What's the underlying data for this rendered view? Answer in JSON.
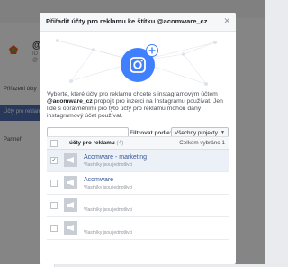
{
  "background": {
    "page_name": "@",
    "page_sub": [
      "ID",
      "@"
    ],
    "sidebar": [
      {
        "label": "Přiřazení účty"
      },
      {
        "label": "Účty pro reklamu",
        "active": true
      },
      {
        "label": "Partneři"
      }
    ]
  },
  "modal": {
    "title": "Přiřadit účty pro reklamu ke štítku @acomware_cz",
    "description_pre": "Vyberte, které účty pro reklamu chcete s instagramovým účtem ",
    "description_handle": "@acomware_cz",
    "description_post": " propojit pro inzerci na Instagramu používat. Jen lidé s oprávněními pro tyto účty pro reklamu mohou daný instagramový účet používat.",
    "filter_label": "Filtrovat podle:",
    "filter_value": "Všechny projekty",
    "search_placeholder": "",
    "table": {
      "header_label": "účty pro reklamu",
      "header_count": "(4)",
      "header_total": "Celkem vybráno 1",
      "rows": [
        {
          "name": "Acomware - marketing",
          "meta": "Vlastníky jsou jednotlivci",
          "checked": true
        },
        {
          "name": "Acomware",
          "meta": "Vlastníky jsou jednotlivci",
          "checked": false
        },
        {
          "name": "",
          "meta": "Vlastníky jsou jednotlivci",
          "checked": false
        },
        {
          "name": "",
          "meta": "Vlastníky jsou jednotlivci",
          "checked": false
        }
      ]
    }
  },
  "colors": {
    "accent": "#4b6cad",
    "link": "#365899",
    "instagram_badge": "#2d88ff"
  },
  "icons": {
    "close": "close-icon",
    "instagram": "instagram-icon",
    "add": "plus-icon",
    "ad_account": "megaphone-icon"
  }
}
